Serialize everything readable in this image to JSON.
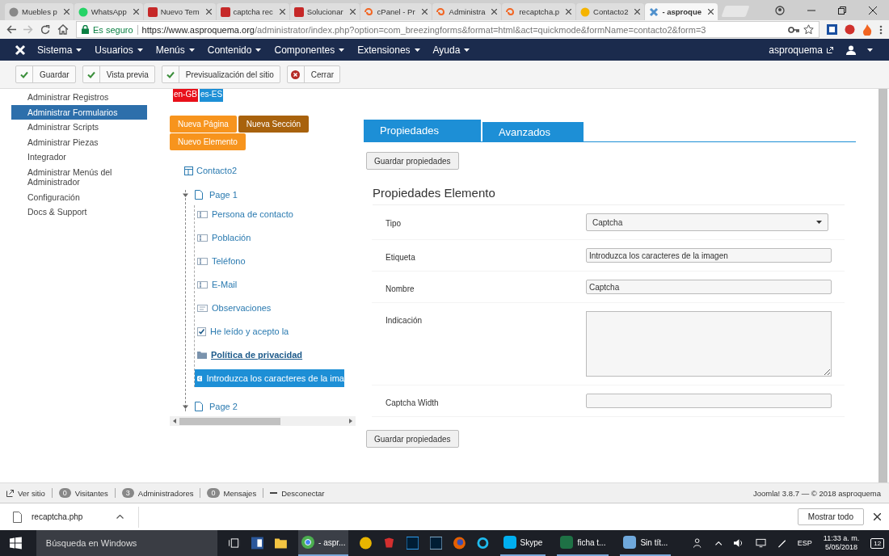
{
  "browser_tabs": [
    {
      "label": "Muebles p",
      "kind": "generic",
      "selected": false
    },
    {
      "label": "WhatsApp",
      "kind": "whatsapp",
      "selected": false
    },
    {
      "label": "Nuevo Tem",
      "kind": "w",
      "selected": false
    },
    {
      "label": "captcha rec",
      "kind": "w",
      "selected": false
    },
    {
      "label": "Solucionar",
      "kind": "w",
      "selected": false
    },
    {
      "label": "cPanel - Pr",
      "kind": "cpanel",
      "selected": false
    },
    {
      "label": "Administra",
      "kind": "cpanel",
      "selected": false
    },
    {
      "label": "recaptcha.p",
      "kind": "cpanel",
      "selected": false
    },
    {
      "label": "Contacto2",
      "kind": "circle",
      "selected": false
    },
    {
      "label": "- asproque",
      "kind": "joomla",
      "selected": true
    }
  ],
  "address_bar": {
    "secure_label": "Es seguro",
    "url_host": "https://www.asproquema.org",
    "url_path": "/administrator/index.php?option=com_breezingforms&format=html&act=quickmode&formName=contacto2&form=3"
  },
  "nav": {
    "menus": [
      "Sistema",
      "Usuarios",
      "Menús",
      "Contenido",
      "Componentes",
      "Extensiones",
      "Ayuda"
    ],
    "user": "asproquema"
  },
  "toolbar": [
    {
      "label": "Guardar",
      "kind": "check"
    },
    {
      "label": "Vista previa",
      "kind": "check"
    },
    {
      "label": "Previsualización del sitio",
      "kind": "check"
    },
    {
      "label": "Cerrar",
      "kind": "close"
    }
  ],
  "sidebar": {
    "items": [
      {
        "label": "Administrar Registros",
        "selected": false
      },
      {
        "label": "Administrar Formularios",
        "selected": true
      },
      {
        "label": "Administrar Scripts",
        "selected": false
      },
      {
        "label": "Administrar Piezas",
        "selected": false
      },
      {
        "label": "Integrador",
        "selected": false
      },
      {
        "label": "Administrar Menús del Administrador",
        "selected": false
      },
      {
        "label": "Configuración",
        "selected": false
      },
      {
        "label": "Docs & Support",
        "selected": false
      }
    ]
  },
  "languages": [
    {
      "label": "en-GB",
      "color": "#e8101a"
    },
    {
      "label": "es-ES",
      "color": "#1d8fd6"
    }
  ],
  "form_buttons": [
    {
      "label": "Nueva Página",
      "color": "#f7941d"
    },
    {
      "label": "Nueva Sección",
      "color": "#a8620d"
    },
    {
      "label": "Nuevo Elemento",
      "color": "#f7941d"
    }
  ],
  "tree": {
    "label": "Contacto2",
    "children": [
      {
        "label": "Page 1",
        "expanded": true,
        "children": [
          {
            "label": "Persona de contacto",
            "kind": "text",
            "selected": false
          },
          {
            "label": "Población",
            "kind": "text",
            "selected": false
          },
          {
            "label": "Teléfono",
            "kind": "text",
            "selected": false
          },
          {
            "label": "E-Mail",
            "kind": "text",
            "selected": false
          },
          {
            "label": "Observaciones",
            "kind": "textarea",
            "selected": false
          },
          {
            "label": "He leído y acepto la",
            "kind": "checkbox",
            "selected": false
          },
          {
            "label": "Política de privacidad",
            "kind": "section",
            "selected": false
          },
          {
            "label": "Introduzca los caracteres de la ima",
            "kind": "captcha",
            "selected": true
          }
        ]
      },
      {
        "label": "Page 2",
        "expanded": true
      }
    ]
  },
  "panel_tabs": [
    {
      "label": "Propiedades",
      "selected": true
    },
    {
      "label": "Avanzados",
      "selected": false
    }
  ],
  "save_button": "Guardar propiedades",
  "section_title": "Propiedades Elemento",
  "fields": [
    {
      "label": "Tipo",
      "kind": "select",
      "value": "Captcha"
    },
    {
      "label": "Etiqueta",
      "kind": "input",
      "value": "Introduzca los caracteres de la imagen"
    },
    {
      "label": "Nombre",
      "kind": "input",
      "value": "Captcha"
    },
    {
      "label": "Indicación",
      "kind": "textarea"
    },
    {
      "label": "Captcha Width",
      "kind": "input"
    }
  ],
  "save_button_bottom": "Guardar propiedades",
  "status_bar": {
    "view_site": "Ver sitio",
    "counters": [
      {
        "count": "0",
        "label": "Visitantes"
      },
      {
        "count": "3",
        "label": "Administradores"
      },
      {
        "count": "0",
        "label": "Mensajes"
      }
    ],
    "logout": "Desconectar",
    "version": "Joomla! 3.8.7 — © 2018 asproquema"
  },
  "download_bar": {
    "file": "recaptcha.php",
    "show_all": "Mostrar todo"
  },
  "taskbar": {
    "search": "Búsqueda en Windows",
    "apps": [
      {
        "label": "- aspr...",
        "kind": "chrome"
      },
      {
        "label": "Skype",
        "kind": "skype"
      },
      {
        "label": "ficha t...",
        "kind": "excel"
      },
      {
        "label": "Sin tít...",
        "kind": "notepad"
      }
    ],
    "language": "ESP",
    "time": "11:33 a. m.",
    "date": "5/05/2018",
    "notifications": "12"
  }
}
